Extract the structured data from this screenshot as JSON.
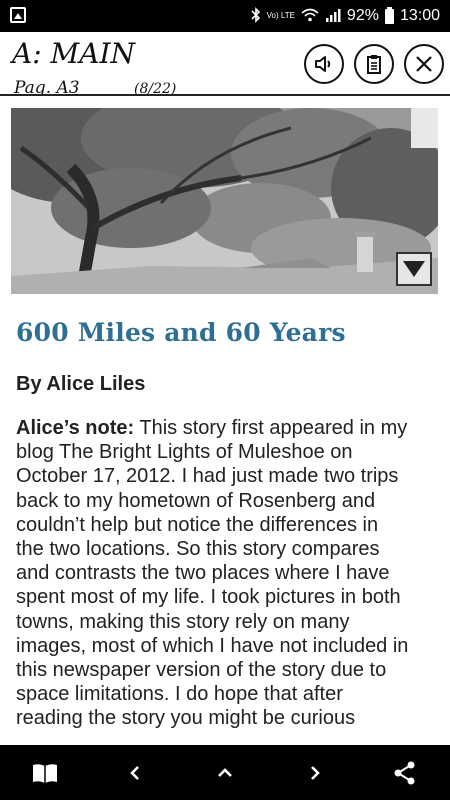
{
  "status_bar": {
    "battery": "92%",
    "time": "13:00",
    "network_label": "Vo) LTE",
    "icons": [
      "image-notification-icon",
      "bluetooth-icon",
      "wifi-icon",
      "signal-icon",
      "battery-icon"
    ]
  },
  "header": {
    "section_title": "A: MAIN",
    "page_label": "Pag. A3",
    "page_count": "(8/22)",
    "buttons": [
      "speaker-icon",
      "clipboard-icon",
      "close-icon"
    ]
  },
  "banner": {
    "toggle_icon": "triangle-down-icon",
    "image_description": "tree-branches-over-house-rooftop"
  },
  "article": {
    "headline": "600 Miles and 60 Years",
    "byline": "By Alice Liles",
    "note_label": "Alice’s note:",
    "body_lines": [
      " This story first appeared in my",
      "blog The Bright Lights of Muleshoe on",
      "October 17, 2012. I had just made two trips",
      "back to my hometown of Rosenberg and",
      "couldn’t help but notice the differences in",
      "the two locations. So this story compares",
      "and contrasts the two places where I have",
      "spent most of my life. I took pictures in both",
      "towns, making this story rely on many",
      "images, most of which I have not included in",
      "this newspaper version of the story due to",
      "space limitations. I do hope that after",
      "reading the story you might be curious"
    ],
    "headline_color": "#2f6f95"
  },
  "bottom_nav": {
    "icons": [
      "book-icon",
      "chevron-left-icon",
      "chevron-up-icon",
      "chevron-right-icon",
      "share-icon"
    ]
  }
}
